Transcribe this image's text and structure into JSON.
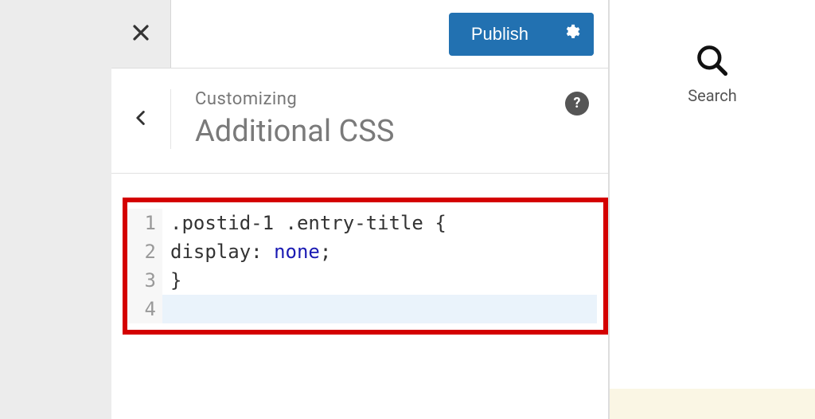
{
  "top_bar": {
    "publish_label": "Publish"
  },
  "section": {
    "eyebrow": "Customizing",
    "title": "Additional CSS",
    "help_symbol": "?"
  },
  "editor": {
    "line_start": 1,
    "lines": [
      {
        "segments": [
          {
            "text": ".postid-1 .entry-title ",
            "type": "sel"
          },
          {
            "text": "{",
            "type": "punc"
          }
        ]
      },
      {
        "segments": [
          {
            "text": "display",
            "type": "prop"
          },
          {
            "text": ": ",
            "type": "punc"
          },
          {
            "text": "none",
            "type": "val"
          },
          {
            "text": ";",
            "type": "punc"
          }
        ]
      },
      {
        "segments": [
          {
            "text": "}",
            "type": "punc"
          }
        ]
      },
      {
        "segments": [],
        "active": true
      }
    ]
  },
  "preview": {
    "search_label": "Search"
  },
  "colors": {
    "accent": "#2271b1",
    "highlight_border": "#d40000"
  }
}
